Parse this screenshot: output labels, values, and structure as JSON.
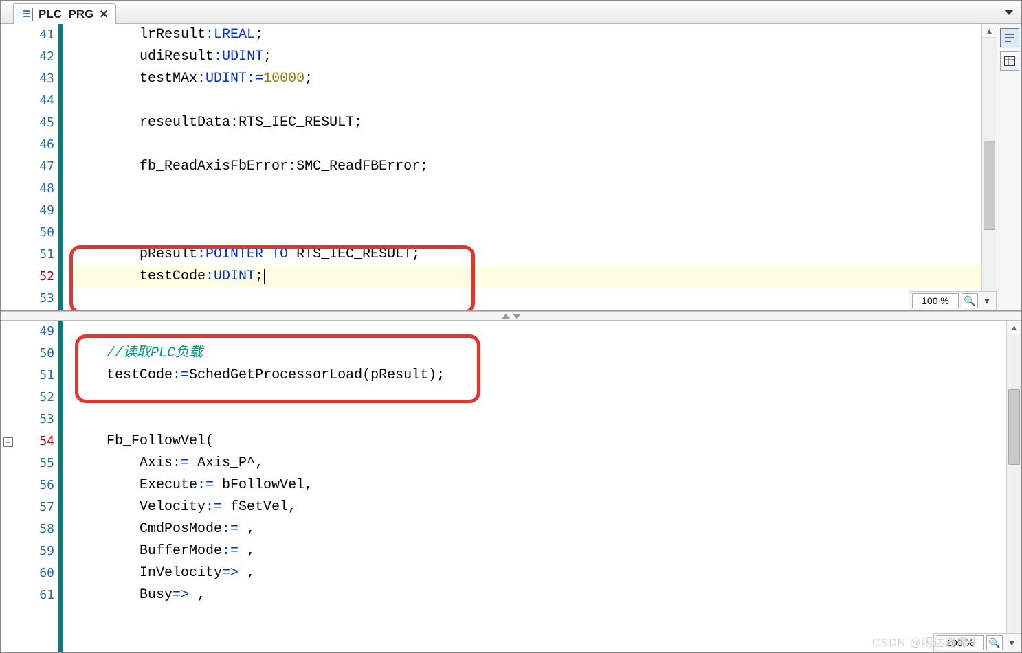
{
  "tab": {
    "title": "PLC_PRG"
  },
  "zoom": {
    "top": "100 %",
    "bottom": "100 %"
  },
  "watermark": "CSDN @闲达逍魔牛",
  "pane_top": {
    "lines": [
      {
        "n": 41,
        "tokens": [
          {
            "t": "        lrResult"
          },
          {
            "t": ":",
            "c": "kw"
          },
          {
            "t": "LREAL",
            "c": "kw"
          },
          {
            "t": ";"
          }
        ]
      },
      {
        "n": 42,
        "tokens": [
          {
            "t": "        udiResult"
          },
          {
            "t": ":",
            "c": "kw"
          },
          {
            "t": "UDINT",
            "c": "kw"
          },
          {
            "t": ";"
          }
        ]
      },
      {
        "n": 43,
        "tokens": [
          {
            "t": "        testMAx"
          },
          {
            "t": ":",
            "c": "kw"
          },
          {
            "t": "UDINT",
            "c": "kw"
          },
          {
            "t": ":=",
            "c": "kw"
          },
          {
            "t": "10000",
            "c": "num"
          },
          {
            "t": ";"
          }
        ]
      },
      {
        "n": 44,
        "tokens": []
      },
      {
        "n": 45,
        "tokens": [
          {
            "t": "        reseultData"
          },
          {
            "t": ":",
            "c": "kw"
          },
          {
            "t": "RTS_IEC_RESULT;"
          }
        ]
      },
      {
        "n": 46,
        "tokens": []
      },
      {
        "n": 47,
        "tokens": [
          {
            "t": "        fb_ReadAxisFbError"
          },
          {
            "t": ":",
            "c": "kw"
          },
          {
            "t": "SMC_ReadFBError;"
          }
        ]
      },
      {
        "n": 48,
        "tokens": []
      },
      {
        "n": 49,
        "tokens": []
      },
      {
        "n": 50,
        "tokens": []
      },
      {
        "n": 51,
        "tokens": [
          {
            "t": "        pResult"
          },
          {
            "t": ":",
            "c": "kw"
          },
          {
            "t": "POINTER TO",
            "c": "kw"
          },
          {
            "t": " RTS_IEC_RESULT;"
          }
        ]
      },
      {
        "n": 52,
        "red": true,
        "hl": true,
        "tokens": [
          {
            "t": "        testCode"
          },
          {
            "t": ":",
            "c": "kw"
          },
          {
            "t": "UDINT",
            "c": "kw"
          },
          {
            "t": ";"
          }
        ],
        "cursor": true
      },
      {
        "n": 53,
        "tokens": []
      }
    ]
  },
  "pane_bot": {
    "lines": [
      {
        "n": 49,
        "tokens": []
      },
      {
        "n": 50,
        "tokens": [
          {
            "t": "    "
          },
          {
            "t": "//读取PLC负载",
            "c": "cmt"
          }
        ]
      },
      {
        "n": 51,
        "tokens": [
          {
            "t": "    testCode"
          },
          {
            "t": ":=",
            "c": "kw"
          },
          {
            "t": "SchedGetProcessorLoad"
          },
          {
            "t": "(pResult);"
          }
        ]
      },
      {
        "n": 52,
        "tokens": []
      },
      {
        "n": 53,
        "tokens": []
      },
      {
        "n": 54,
        "red": true,
        "fold": "-",
        "tokens": [
          {
            "t": "    Fb_FollowVel("
          }
        ]
      },
      {
        "n": 55,
        "tokens": [
          {
            "t": "        Axis"
          },
          {
            "t": ":=",
            "c": "kw"
          },
          {
            "t": " Axis_P^,"
          }
        ]
      },
      {
        "n": 56,
        "tokens": [
          {
            "t": "        Execute"
          },
          {
            "t": ":=",
            "c": "kw"
          },
          {
            "t": " bFollowVel,"
          }
        ]
      },
      {
        "n": 57,
        "tokens": [
          {
            "t": "        Velocity"
          },
          {
            "t": ":=",
            "c": "kw"
          },
          {
            "t": " fSetVel,"
          }
        ]
      },
      {
        "n": 58,
        "tokens": [
          {
            "t": "        CmdPosMode"
          },
          {
            "t": ":=",
            "c": "kw"
          },
          {
            "t": " ,"
          }
        ]
      },
      {
        "n": 59,
        "tokens": [
          {
            "t": "        BufferMode"
          },
          {
            "t": ":=",
            "c": "kw"
          },
          {
            "t": " ,"
          }
        ]
      },
      {
        "n": 60,
        "tokens": [
          {
            "t": "        InVelocity"
          },
          {
            "t": "=>",
            "c": "kw"
          },
          {
            "t": " ,"
          }
        ]
      },
      {
        "n": 61,
        "tokens": [
          {
            "t": "        Busy"
          },
          {
            "t": "=>",
            "c": "kw"
          },
          {
            "t": " ,"
          }
        ]
      }
    ]
  }
}
